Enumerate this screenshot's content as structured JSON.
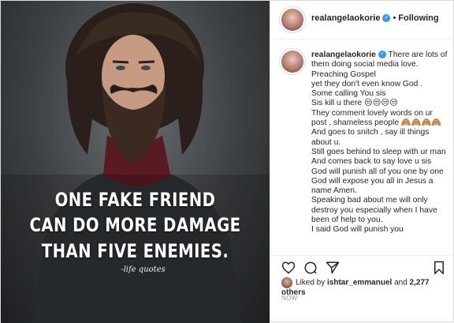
{
  "post": {
    "image": {
      "quote_lines": [
        "ONE FAKE FRIEND",
        "CAN DO MORE DAMAGE",
        "THAN FIVE ENEMIES."
      ],
      "signature": "-life quotes"
    },
    "header": {
      "username": "realangelaokorie",
      "separator": "•",
      "follow_label": "Following"
    },
    "caption": {
      "username": "realangelaokorie",
      "lines": [
        "There are lots of them doing social media love.",
        "Preaching Gospel",
        "yet they don't even know God .",
        "Some calling You sis",
        "Sis kill u there 😒😒😒😒",
        "They comment lovely words on ur post , shameless people 🙈🙈🙈🙈",
        "And goes to snitch , say ill things about u.",
        "Still goes behind to sleep with ur man",
        "And comes back to say love u sis",
        "God will punish all of you one by one",
        "God will expose you all in Jesus a name Amen.",
        "Speaking bad about me will only destroy you especially when I have been of help to you.",
        "I said God will punish you"
      ]
    },
    "likes": {
      "prefix": "Liked by ",
      "user": "ishtar_emmanuel",
      "middle": " and ",
      "count": "2,277 others"
    },
    "time": "NOW",
    "icons": [
      "heart-icon",
      "comment-icon",
      "share-icon",
      "bookmark-icon",
      "verified-icon"
    ]
  }
}
